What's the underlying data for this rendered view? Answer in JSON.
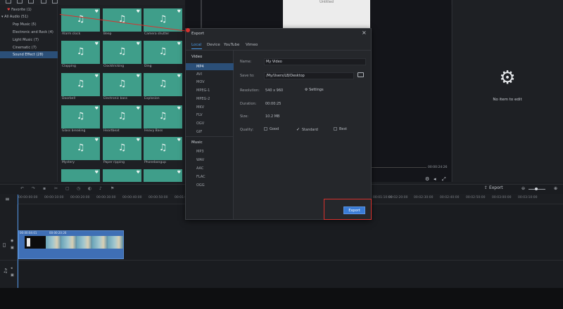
{
  "sidebar": {
    "items": [
      {
        "label": "Favorite (1)"
      },
      {
        "label": "All Audio (51)"
      },
      {
        "label": "Pop Music (5)"
      },
      {
        "label": "Electronic and Rock (4)"
      },
      {
        "label": "Light Music (7)"
      },
      {
        "label": "Cinematic (7)"
      },
      {
        "label": "Sound Effect (28)"
      }
    ]
  },
  "media": {
    "tiles": [
      "Alarm clock",
      "Beep",
      "Camera shutter",
      "Clapping",
      "Clocktricking",
      "Ding",
      "Doorbell",
      "Electronic bass",
      "Explosion",
      "Glass breaking",
      "Heartbeat",
      "Heavy Bass",
      "Mystery",
      "Paper ripping",
      "Phonebangup",
      "",
      "",
      ""
    ]
  },
  "preview": {
    "title": "Untitled",
    "time": "00:00:24:26"
  },
  "right_panel": {
    "empty_text": "No item to edit"
  },
  "timeline": {
    "export_label": "Export",
    "ruler": [
      "00:00:00:00",
      "00:00:10:00",
      "00:00:20:00",
      "00:00:30:00",
      "00:00:40:00",
      "00:00:50:00",
      "00:01:00:00",
      "00:01:10:00",
      "00:02:20:00",
      "00:02:30:00",
      "00:02:40:00",
      "00:02:50:00",
      "00:03:00:00",
      "00:03:10:00"
    ],
    "clip_labels": [
      "00:00:04:01",
      "00:00:20:26"
    ]
  },
  "dialog": {
    "title": "Export",
    "tabs": [
      "Local",
      "Device",
      "YouTube",
      "Vimeo"
    ],
    "video_heading": "Video",
    "video_formats": [
      "MP4",
      "AVI",
      "MOV",
      "MPEG-1",
      "MPEG-2",
      "MKV",
      "FLV",
      "OGV",
      "GIF"
    ],
    "music_heading": "Music",
    "music_formats": [
      "MP3",
      "WAV",
      "AAC",
      "FLAC",
      "OGG"
    ],
    "name_label": "Name:",
    "name_value": "My Video",
    "save_label": "Save to:",
    "save_value": "/My/Users/LB/Desktop",
    "resolution_label": "Resolution:",
    "resolution_value": "540 x 960",
    "settings_label": "Settings",
    "duration_label": "Duration:",
    "duration_value": "00:00:25",
    "size_label": "Size:",
    "size_value": "10.2 MB",
    "quality_label": "Quality:",
    "quality_options": [
      "Good",
      "Standard",
      "Best"
    ],
    "export_button": "Export"
  },
  "colors": {
    "accent": "#3a7bd5",
    "tile": "#3f9e8a",
    "highlight": "#d9322e"
  }
}
